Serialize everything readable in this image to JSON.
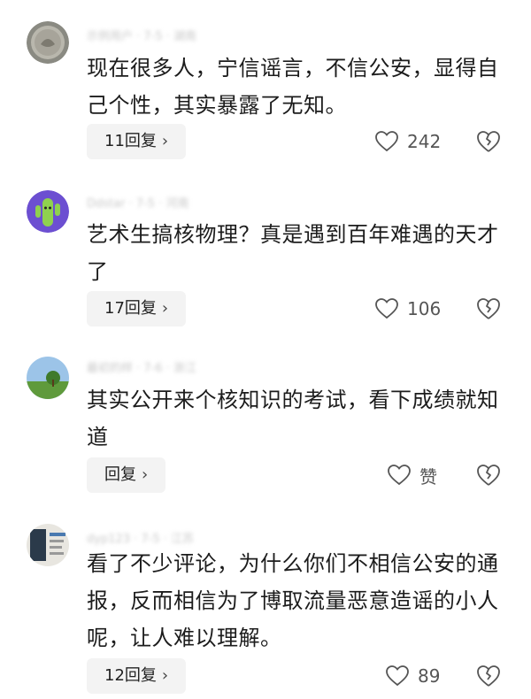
{
  "comments": [
    {
      "avatar": "coin-avatar",
      "meta": "示例用户 · 7-5 · 湖南",
      "text": "现在很多人，宁信谣言，不信公安，显得自己个性，其实暴露了无知。",
      "reply_label": "11回复",
      "likes": "242"
    },
    {
      "avatar": "cactus-avatar",
      "meta": "Ddstar · 7-5 · 河南",
      "text": "艺术生搞核物理？真是遇到百年难遇的天才了",
      "reply_label": "17回复",
      "likes": "106"
    },
    {
      "avatar": "landscape-avatar",
      "meta": "最初的样 · 7-6 · 浙江",
      "text": "其实公开来个核知识的考试，看下成绩就知道",
      "reply_label": "回复",
      "likes": "赞"
    },
    {
      "avatar": "photo-avatar",
      "meta": "dyp123 · 7-5 · 江苏",
      "text": "看了不少评论，为什么你们不相信公安的通报，反而相信为了博取流量恶意造谣的小人呢，让人难以理解。",
      "reply_label": "12回复",
      "likes": "89"
    }
  ]
}
